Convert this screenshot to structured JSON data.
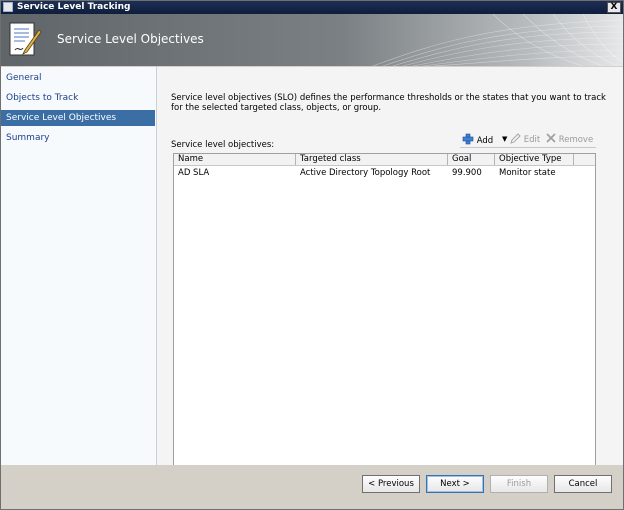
{
  "window": {
    "title": "Service Level Tracking",
    "close_label": "X"
  },
  "header": {
    "title": "Service Level Objectives"
  },
  "nav": {
    "items": [
      {
        "label": "General"
      },
      {
        "label": "Objects to Track"
      },
      {
        "label": "Service Level Objectives",
        "selected": true
      },
      {
        "label": "Summary"
      }
    ]
  },
  "main": {
    "description": "Service level objectives (SLO) defines the performance thresholds or the states that you want to track for the selected targeted class, objects, or group.",
    "list_label": "Service level objectives:",
    "toolbar": {
      "add_label": "Add",
      "edit_label": "Edit",
      "remove_label": "Remove"
    },
    "table": {
      "columns": [
        "Name",
        "Targeted class",
        "Goal",
        "Objective Type"
      ],
      "rows": [
        {
          "name": "AD SLA",
          "targeted_class": "Active Directory Topology Root",
          "goal": "99.900",
          "objective_type": "Monitor state"
        }
      ]
    }
  },
  "footer": {
    "previous_label": "< Previous",
    "next_label": "Next >",
    "finish_label": "Finish",
    "cancel_label": "Cancel"
  },
  "colors": {
    "title_bar": "#0f1e3c",
    "nav_selected": "#3a6ea5",
    "nav_link": "#1d3f8c"
  }
}
